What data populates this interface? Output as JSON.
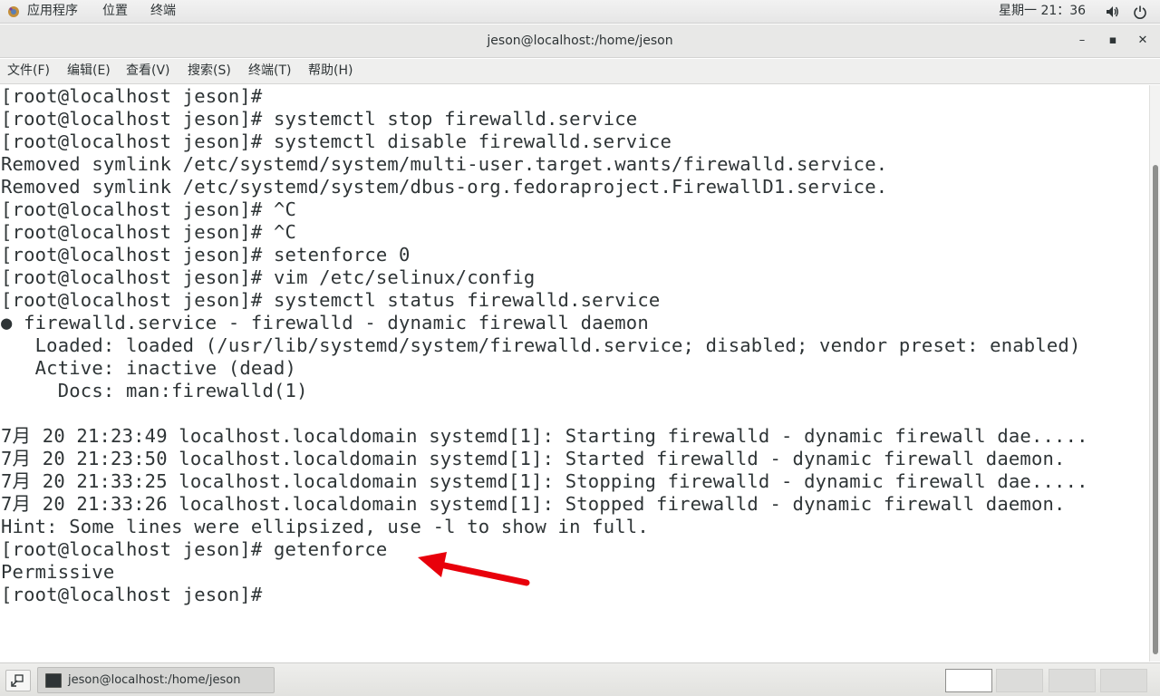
{
  "top_panel": {
    "applications": "应用程序",
    "places": "位置",
    "terminal": "终端",
    "clock": "星期一 21：36",
    "volume_icon": "volume-icon",
    "power_icon": "power-icon"
  },
  "window": {
    "title": "jeson@localhost:/home/jeson",
    "minimize": "–",
    "maximize": "▪",
    "close": "✕"
  },
  "menubar": {
    "file": "文件(F)",
    "edit": "编辑(E)",
    "view": "查看(V)",
    "search": "搜索(S)",
    "terminal": "终端(T)",
    "help": "帮助(H)"
  },
  "terminal": {
    "lines": [
      "[root@localhost jeson]#",
      "[root@localhost jeson]# systemctl stop firewalld.service",
      "[root@localhost jeson]# systemctl disable firewalld.service",
      "Removed symlink /etc/systemd/system/multi-user.target.wants/firewalld.service.",
      "Removed symlink /etc/systemd/system/dbus-org.fedoraproject.FirewallD1.service.",
      "[root@localhost jeson]# ^C",
      "[root@localhost jeson]# ^C",
      "[root@localhost jeson]# setenforce 0",
      "[root@localhost jeson]# vim /etc/selinux/config",
      "[root@localhost jeson]# systemctl status firewalld.service",
      "● firewalld.service - firewalld - dynamic firewall daemon",
      "   Loaded: loaded (/usr/lib/systemd/system/firewalld.service; disabled; vendor preset: enabled)",
      "   Active: inactive (dead)",
      "     Docs: man:firewalld(1)",
      "",
      "7月 20 21:23:49 localhost.localdomain systemd[1]: Starting firewalld - dynamic firewall dae.....",
      "7月 20 21:23:50 localhost.localdomain systemd[1]: Started firewalld - dynamic firewall daemon.",
      "7月 20 21:33:25 localhost.localdomain systemd[1]: Stopping firewalld - dynamic firewall dae.....",
      "7月 20 21:33:26 localhost.localdomain systemd[1]: Stopped firewalld - dynamic firewall daemon.",
      "Hint: Some lines were ellipsized, use -l to show in full.",
      "[root@localhost jeson]# getenforce",
      "Permissive",
      "[root@localhost jeson]#"
    ]
  },
  "taskbar": {
    "task_label": "jeson@localhost:/home/jeson"
  },
  "colors": {
    "terminal_text": "#2e3436",
    "annotation_arrow": "#e8000b"
  }
}
